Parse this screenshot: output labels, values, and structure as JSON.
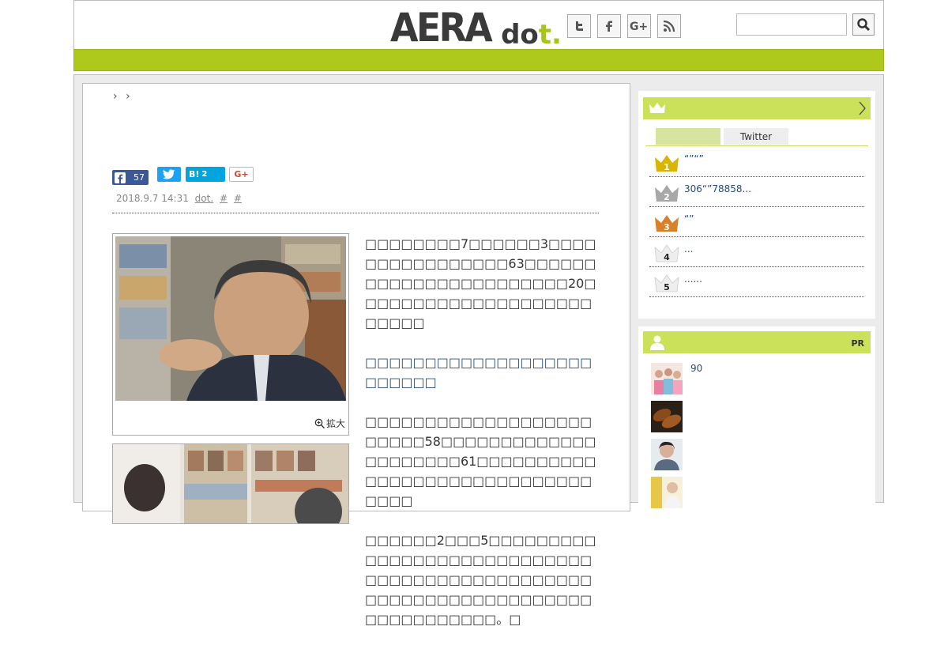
{
  "header": {
    "logo_main": "AERA",
    "logo_sub_prefix": "do",
    "logo_sub_suffix": "t.",
    "search_placeholder": ""
  },
  "breadcrumb": [
    "›",
    "›"
  ],
  "share": {
    "facebook_count": "57",
    "hatena_label": "B!",
    "hatena_count": "2",
    "gplus_label": "G+"
  },
  "meta": {
    "date": "2018.9.7 14:31",
    "source": "dot.",
    "tag1": "#",
    "tag2": "#"
  },
  "photo": {
    "zoom_label": "拡大"
  },
  "body": {
    "p1": "□□□□□□□□7□□□□□□3□□□□□□□□□□□□□□□□63□□□□□□□□□□□□□□□□□□□□□□□20□□□□□□□□□□□□□□□□□□□□□□□□□",
    "subhead": "□□□□□□□□□□□□□□□□□□□□□□□□□",
    "p2": "□□□□□□□□□□□□□□□□□□□□□□□□58□□□□□□□□□□□□□□□□□□□□□61□□□□□□□□□□□□□□□□□□□□□□□□□□□□□□□□□",
    "p3": "□□□□□□2□□□5□□□□□□□□□□□□□□□□□□□□□□□□□□□□□□□□□□□□□□□□□□□□□□□□□□□□□□□□□□□□□□□□□□□□□□□□□□□□□。□"
  },
  "ranking": {
    "tabs": [
      "",
      "Twitter"
    ],
    "items": [
      {
        "rank": "1",
        "text": "“”“”",
        "color": "#d9b500"
      },
      {
        "rank": "2",
        "text": "306“”78858...",
        "color": "#a8a8a8"
      },
      {
        "rank": "3",
        "text": "“”",
        "color": "#d9802a"
      },
      {
        "rank": "4",
        "text": "...",
        "color": "#e8e8e8"
      },
      {
        "rank": "5",
        "text": "......",
        "color": "#e8e8e8"
      }
    ]
  },
  "pr": {
    "label": "PR",
    "items": [
      {
        "text": "90"
      },
      {
        "text": ""
      },
      {
        "text": ""
      },
      {
        "text": ""
      }
    ]
  },
  "colors": {
    "brand_green": "#afc81c",
    "sidebar_head": "#cbe15a",
    "facebook": "#3b5998",
    "twitter": "#1da1f2",
    "hatena": "#00a4de"
  }
}
